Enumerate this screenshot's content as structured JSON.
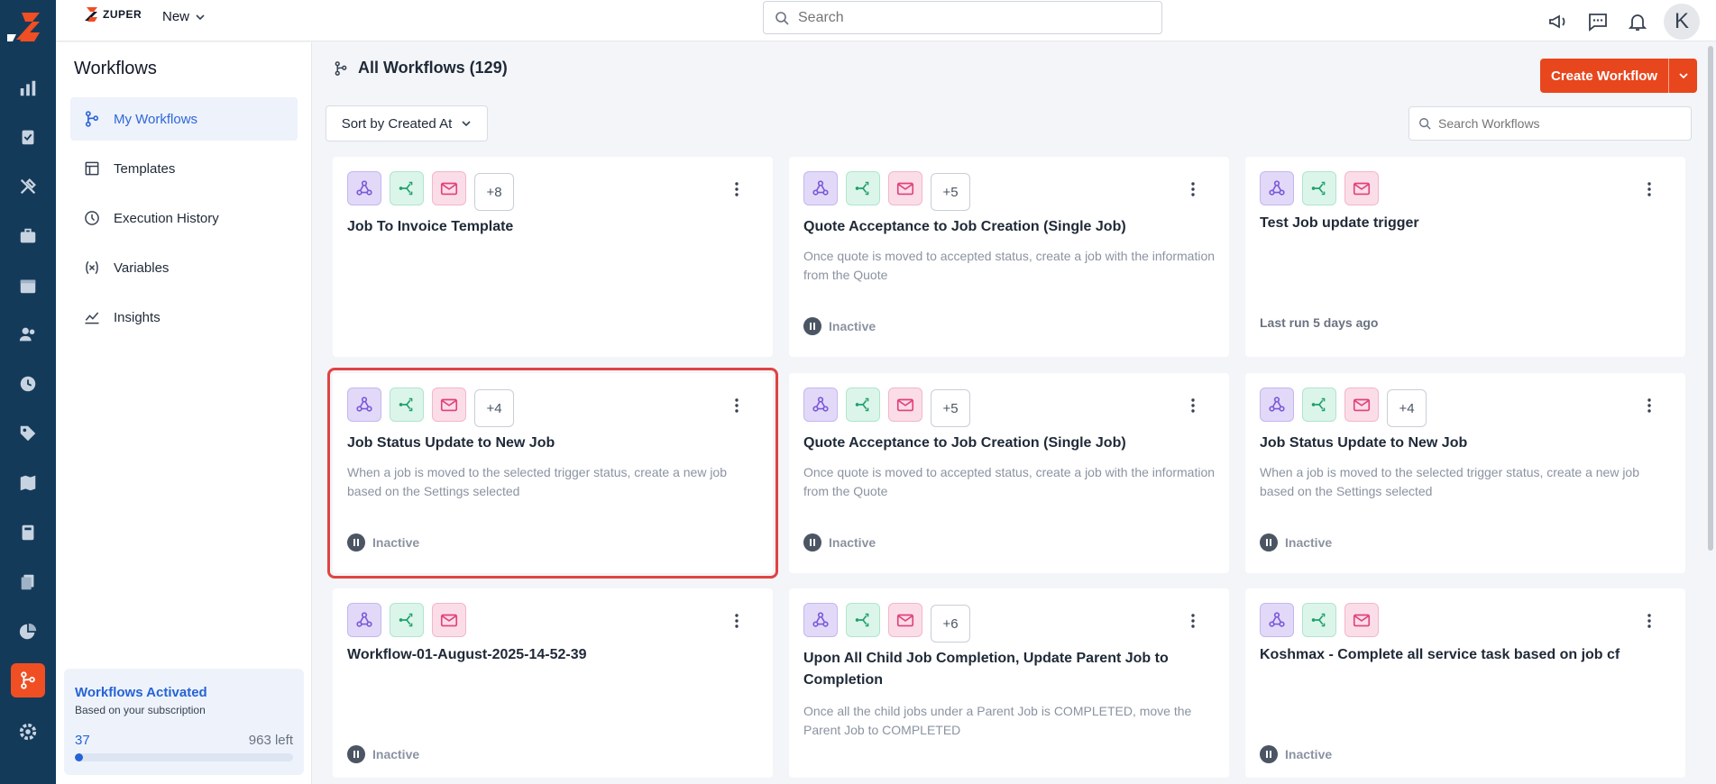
{
  "app": {
    "brand": "ZUPER",
    "new_label": "New"
  },
  "search": {
    "placeholder": "Search"
  },
  "sidebar": {
    "title": "Workflows",
    "items": [
      {
        "label": "My Workflows",
        "icon": "workflow-icon",
        "active": true
      },
      {
        "label": "Templates",
        "icon": "template-icon"
      },
      {
        "label": "Execution History",
        "icon": "history-icon"
      },
      {
        "label": "Variables",
        "icon": "variable-icon"
      },
      {
        "label": "Insights",
        "icon": "insights-icon"
      }
    ],
    "quota": {
      "title": "Workflows Activated",
      "subtitle": "Based on your subscription",
      "used": "37",
      "left": "963 left",
      "fraction": 0.037
    }
  },
  "main": {
    "heading": "All Workflows (129)",
    "create_label": "Create Workflow",
    "sort_label": "Sort by Created At",
    "search_placeholder": "Search Workflows",
    "cards": [
      {
        "title": "Job To Invoice Template",
        "more": "+8",
        "desc": "",
        "status": "",
        "lastrun": ""
      },
      {
        "title": "Quote Acceptance to Job Creation (Single Job)",
        "more": "+5",
        "desc": "Once quote is moved to accepted status, create a job with the information from the Quote",
        "status": "Inactive",
        "lastrun": ""
      },
      {
        "title": "Test Job update trigger",
        "more": "",
        "desc": "",
        "status": "",
        "lastrun": "Last run 5 days ago"
      },
      {
        "title": "Job Status Update to New Job",
        "more": "+4",
        "desc": "When a job is moved to the selected trigger status, create a new job based on the Settings selected",
        "status": "Inactive",
        "lastrun": ""
      },
      {
        "title": "Quote Acceptance to Job Creation (Single Job)",
        "more": "+5",
        "desc": "Once quote is moved to accepted status, create a job with the information from the Quote",
        "status": "Inactive",
        "lastrun": ""
      },
      {
        "title": "Job Status Update to New Job",
        "more": "+4",
        "desc": "When a job is moved to the selected trigger status, create a new job based on the Settings selected",
        "status": "Inactive",
        "lastrun": ""
      },
      {
        "title": "Workflow-01-August-2025-14-52-39",
        "more": "",
        "desc": "",
        "status": "Inactive",
        "lastrun": ""
      },
      {
        "title": "Upon All Child Job Completion, Update Parent Job to Completion",
        "more": "+6",
        "desc": "Once all the child jobs under a Parent Job is COMPLETED, move the Parent Job to COMPLETED",
        "status": "",
        "lastrun": ""
      },
      {
        "title": "Koshmax - Complete all service task based on job cf",
        "more": "",
        "desc": "",
        "status": "Inactive",
        "lastrun": ""
      }
    ]
  },
  "colors": {
    "accent": "#e8461d",
    "rail": "#143a5a",
    "link": "#2563d6",
    "selected_outline": "#e04343"
  }
}
